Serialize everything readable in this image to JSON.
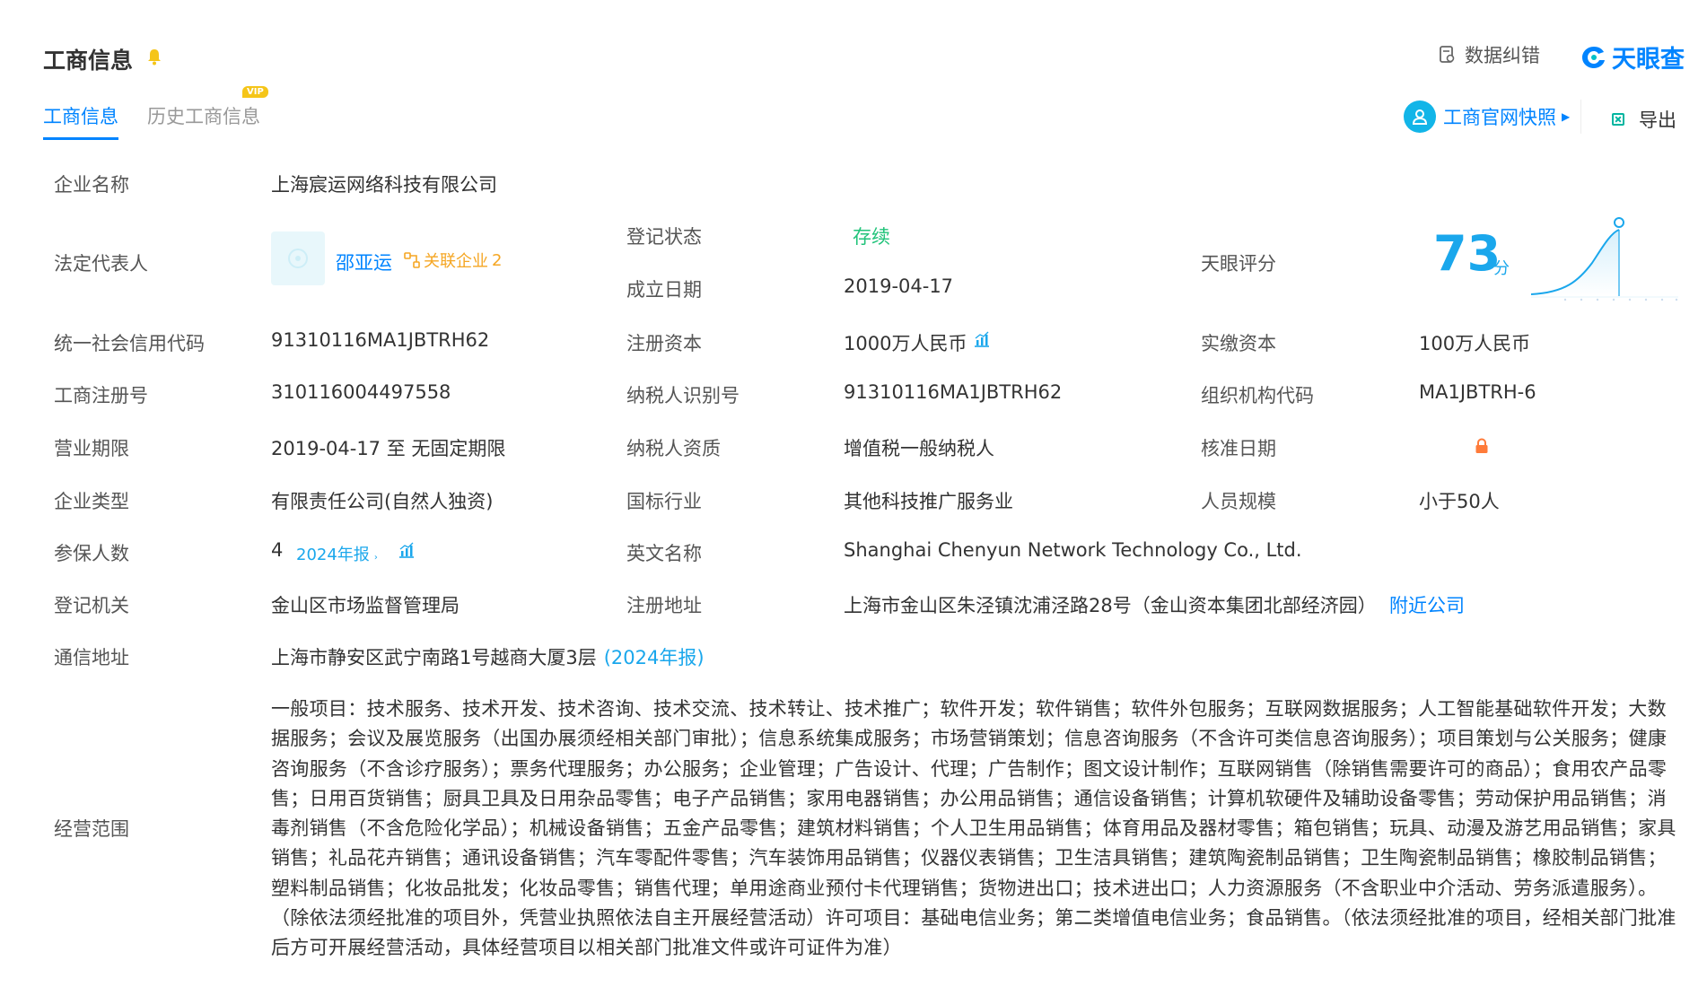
{
  "header": {
    "title": "工商信息",
    "correct_label": "数据纠错",
    "brand_name": "天眼查",
    "tabs": [
      {
        "label": "工商信息",
        "active": true
      },
      {
        "label": "历史工商信息",
        "active": false
      }
    ],
    "vip_badge": "VIP",
    "snapshot_label": "工商官网快照",
    "export_label": "导出"
  },
  "fields": {
    "company_name_label": "企业名称",
    "company_name": "上海宸运网络科技有限公司",
    "legal_rep_label": "法定代表人",
    "legal_rep": "邵亚运",
    "related_companies_label": "关联企业",
    "related_companies_count": "2",
    "reg_status_label": "登记状态",
    "reg_status": "存续",
    "founded_label": "成立日期",
    "founded": "2019-04-17",
    "tianyan_score_label": "天眼评分",
    "tianyan_score": "73",
    "tianyan_score_unit": "分",
    "credit_code_label": "统一社会信用代码",
    "credit_code": "91310116MA1JBTRH62",
    "reg_capital_label": "注册资本",
    "reg_capital": "1000万人民币",
    "paid_capital_label": "实缴资本",
    "paid_capital": "100万人民币",
    "biz_reg_no_label": "工商注册号",
    "biz_reg_no": "310116004497558",
    "taxpayer_id_label": "纳税人识别号",
    "taxpayer_id": "91310116MA1JBTRH62",
    "org_code_label": "组织机构代码",
    "org_code": "MA1JBTRH-6",
    "term_label": "营业期限",
    "term": "2019-04-17 至 无固定期限",
    "taxpayer_qual_label": "纳税人资质",
    "taxpayer_qual": "增值税一般纳税人",
    "approval_date_label": "核准日期",
    "company_type_label": "企业类型",
    "company_type": "有限责任公司(自然人独资)",
    "industry_label": "国标行业",
    "industry": "其他科技推广服务业",
    "staff_size_label": "人员规模",
    "staff_size": "小于50人",
    "insured_label": "参保人数",
    "insured": "4",
    "insured_report": "2024年报",
    "english_name_label": "英文名称",
    "english_name": "Shanghai Chenyun Network Technology Co., Ltd.",
    "authority_label": "登记机关",
    "authority": "金山区市场监督管理局",
    "reg_address_label": "注册地址",
    "reg_address": "上海市金山区朱泾镇沈浦泾路28号（金山资本集团北部经济园）",
    "nearby_label": "附近公司",
    "mail_address_label": "通信地址",
    "mail_address": "上海市静安区武宁南路1号越商大厦3层",
    "mail_address_source": "(2024年报)",
    "scope_label": "经营范围",
    "scope": "一般项目：技术服务、技术开发、技术咨询、技术交流、技术转让、技术推广；软件开发；软件销售；软件外包服务；互联网数据服务；人工智能基础软件开发；大数据服务；会议及展览服务（出国办展须经相关部门审批）；信息系统集成服务；市场营销策划；信息咨询服务（不含许可类信息咨询服务）；项目策划与公关服务；健康咨询服务（不含诊疗服务）；票务代理服务；办公服务；企业管理；广告设计、代理；广告制作；图文设计制作；互联网销售（除销售需要许可的商品）；食用农产品零售；日用百货销售；厨具卫具及日用杂品零售；电子产品销售；家用电器销售；办公用品销售；通信设备销售；计算机软硬件及辅助设备零售；劳动保护用品销售；消毒剂销售（不含危险化学品）；机械设备销售；五金产品零售；建筑材料销售；个人卫生用品销售；体育用品及器材零售；箱包销售；玩具、动漫及游艺用品销售；家具销售；礼品花卉销售；通讯设备销售；汽车零配件零售；汽车装饰用品销售；仪器仪表销售；卫生洁具销售；建筑陶瓷制品销售；卫生陶瓷制品销售；橡胶制品销售；塑料制品销售；化妆品批发；化妆品零售；销售代理；单用途商业预付卡代理销售；货物进出口；技术进出口；人力资源服务（不含职业中介活动、劳务派遣服务）。（除依法须经批准的项目外，凭营业执照依法自主开展经营活动）许可项目：基础电信业务；第二类增值电信业务；食品销售。（依法须经批准的项目，经相关部门批准后方可开展经营活动，具体经营项目以相关部门批准文件或许可证件为准）"
  },
  "colors": {
    "accent": "#0084ff",
    "status_green": "#21c37a",
    "score_blue": "#1aa7ec",
    "related_orange": "#f5a623",
    "lock_orange": "#ff7b3a"
  },
  "icons": [
    "bell-icon",
    "correct-icon",
    "brand-logo-icon",
    "snapshot-icon",
    "export-icon",
    "avatar-icon",
    "related-icon",
    "capital-chart-icon",
    "insured-chart-icon",
    "lock-icon"
  ]
}
